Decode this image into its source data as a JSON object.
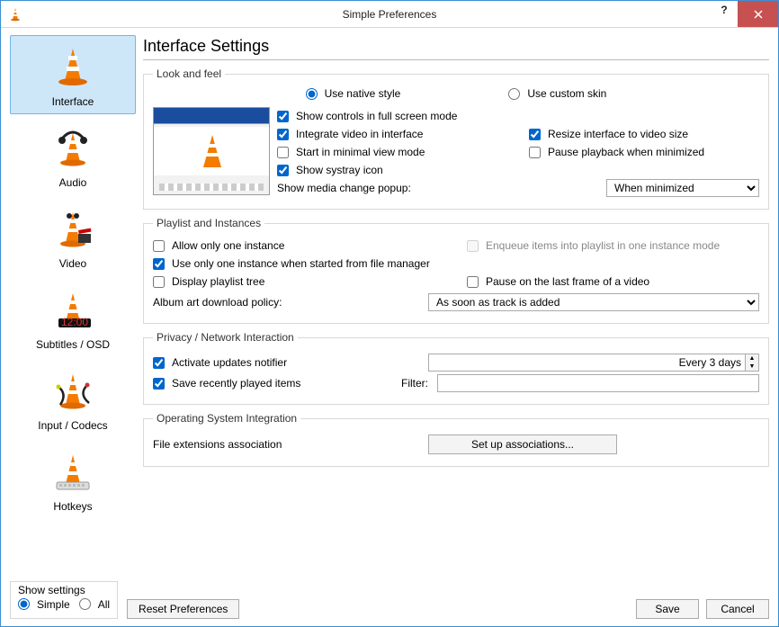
{
  "window": {
    "title": "Simple Preferences"
  },
  "sidebar": {
    "items": [
      {
        "label": "Interface"
      },
      {
        "label": "Audio"
      },
      {
        "label": "Video"
      },
      {
        "label": "Subtitles / OSD"
      },
      {
        "label": "Input / Codecs"
      },
      {
        "label": "Hotkeys"
      }
    ]
  },
  "main": {
    "title": "Interface Settings",
    "look": {
      "legend": "Look and feel",
      "native": "Use native style",
      "custom": "Use custom skin",
      "show_controls": "Show controls in full screen mode",
      "integrate": "Integrate video in interface",
      "resize": "Resize interface to video size",
      "minimal": "Start in minimal view mode",
      "pause_min": "Pause playback when minimized",
      "systray": "Show systray icon",
      "media_change_label": "Show media change popup:",
      "media_change_value": "When minimized"
    },
    "playlist": {
      "legend": "Playlist and Instances",
      "one_instance": "Allow only one instance",
      "enqueue": "Enqueue items into playlist in one instance mode",
      "one_from_fm": "Use only one instance when started from file manager",
      "display_tree": "Display playlist tree",
      "pause_last": "Pause on the last frame of a video",
      "album_art_label": "Album art download policy:",
      "album_art_value": "As soon as track is added"
    },
    "privacy": {
      "legend": "Privacy / Network Interaction",
      "updates": "Activate updates notifier",
      "updates_value": "Every 3 days",
      "save_recent": "Save recently played items",
      "filter_label": "Filter:"
    },
    "os": {
      "legend": "Operating System Integration",
      "ext_label": "File extensions association",
      "setup_btn": "Set up associations..."
    }
  },
  "footer": {
    "show_settings": "Show settings",
    "simple": "Simple",
    "all": "All",
    "reset": "Reset Preferences",
    "save": "Save",
    "cancel": "Cancel"
  }
}
